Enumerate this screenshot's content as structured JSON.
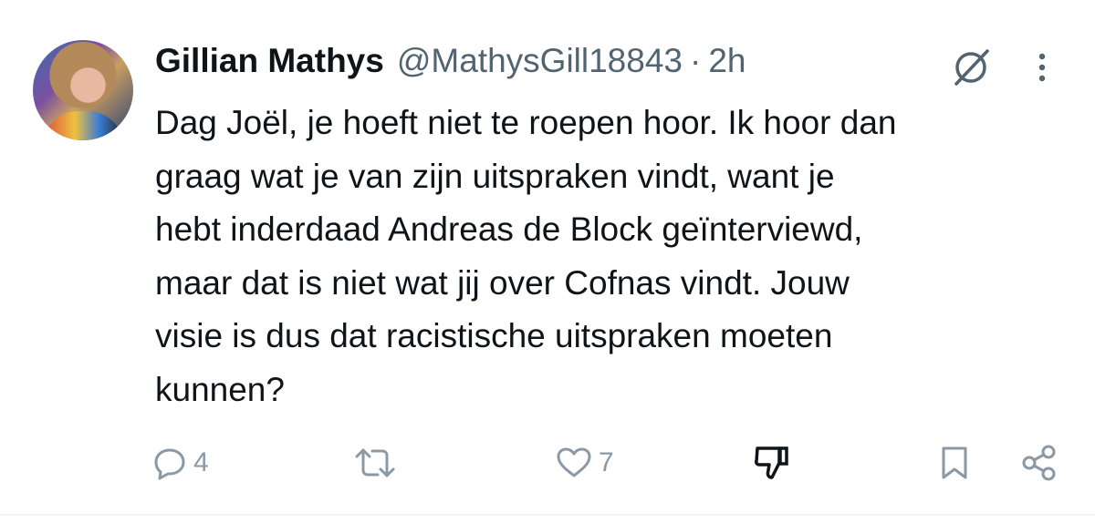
{
  "tweet": {
    "author_name": "Gillian Mathys",
    "handle": "@MathysGill18843",
    "separator": "·",
    "time": "2h",
    "text": "Dag Joël, je hoeft niet te roepen hoor. Ik hoor dan\ngraag wat je van zijn uitspraken vindt, want je\nhebt inderdaad Andreas de Block geïnterviewd,\nmaar dat is niet wat jij over Cofnas vindt.  Jouw\nvisie is dus dat racistische uitspraken moeten\nkunnen?"
  },
  "actions": {
    "replies": "4",
    "retweets": "",
    "likes": "7"
  },
  "icons": {
    "reply": "reply-icon",
    "retweet": "retweet-icon",
    "like": "heart-icon",
    "dislike": "thumbs-down-icon",
    "bookmark": "bookmark-icon",
    "share": "share-icon",
    "grok": "grok-icon",
    "more": "more-icon"
  },
  "colors": {
    "text": "#0f1419",
    "secondary": "#536471",
    "icon": "#8b98a5"
  }
}
